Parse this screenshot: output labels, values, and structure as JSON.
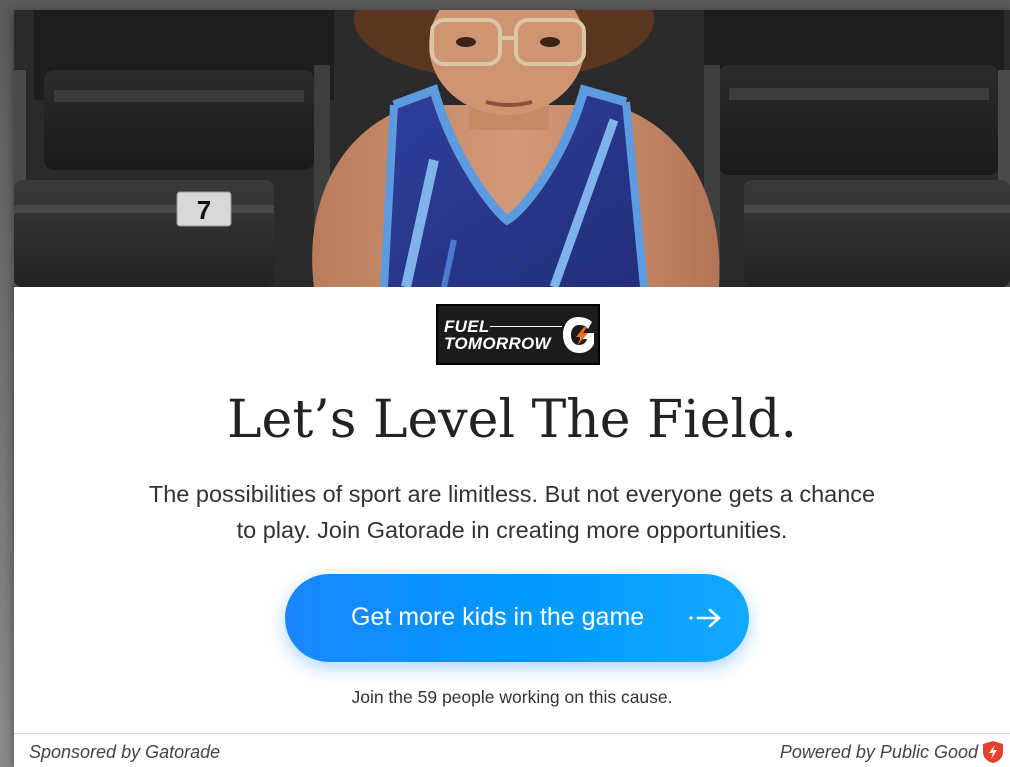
{
  "hero": {
    "seat_number": "7",
    "icon": "athlete-photo"
  },
  "logo": {
    "line1": "FUEL",
    "line2": "TOMORROW",
    "mark": "gatorade-g-bolt-icon"
  },
  "headline": "Let’s Level The Field.",
  "description": {
    "line1": "The possibilities of sport are limitless. But not everyone gets a chance",
    "line2": "to play. Join Gatorade in creating more opportunities."
  },
  "cta": {
    "label": "Get more kids in the game",
    "icon": "arrow-right-icon"
  },
  "participants_text": "Join the 59 people working on this cause.",
  "footer": {
    "sponsored": "Sponsored by Gatorade",
    "powered": "Powered by Public Good",
    "powered_icon": "public-good-shield-icon"
  },
  "colors": {
    "cta_start": "#1a86ff",
    "cta_end": "#13a9ff",
    "text": "#222222",
    "logo_bg": "#1b1b1b",
    "logo_accent": "#f36b21",
    "public_good": "#e8402f"
  }
}
